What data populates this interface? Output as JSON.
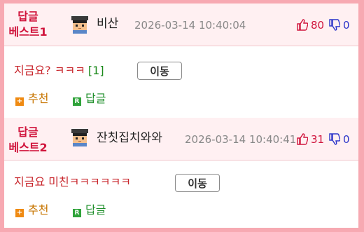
{
  "comments": [
    {
      "best_label_1": "답글",
      "best_label_2": "베스트1",
      "nickname": "비산",
      "datetime": "2026-03-14 10:40:04",
      "upvotes": "80",
      "downvotes": "0",
      "content": "지금요? ㅋㅋㅋ",
      "reply_count": "[1]",
      "move_label": "이동",
      "recommend_label": "추천",
      "reply_label": "답글"
    },
    {
      "best_label_1": "답글",
      "best_label_2": "베스트2",
      "nickname": "잔칫집치와와",
      "datetime": "2026-03-14 10:40:41",
      "upvotes": "31",
      "downvotes": "0",
      "content": "지금요 미친ㅋㅋㅋㅋㅋㅋ",
      "reply_count": "",
      "move_label": "이동",
      "recommend_label": "추천",
      "reply_label": "답글"
    }
  ],
  "icons": {
    "avatar": "pixel-avatar-icon",
    "upvote": "thumbs-up-icon",
    "downvote": "thumbs-down-icon",
    "recommend": "plus-icon",
    "reply": "r-icon"
  },
  "colors": {
    "background": "#f7a9b2",
    "best_label": "#d0143c",
    "content_text": "#c8262c",
    "upvote": "#d0143c",
    "downvote": "#2b34c9"
  }
}
